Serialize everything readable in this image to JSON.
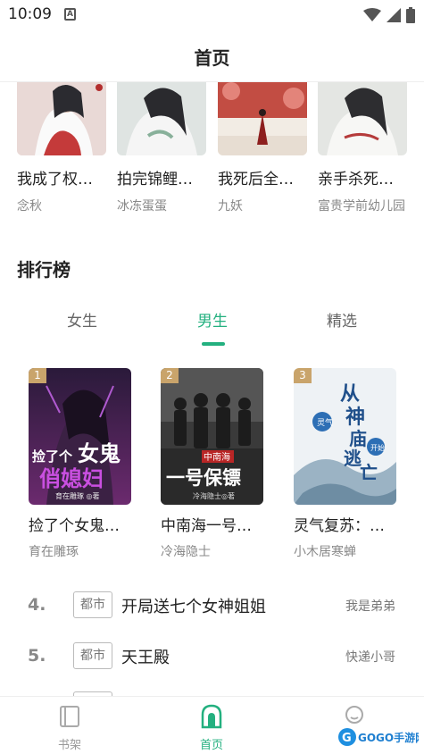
{
  "status_bar": {
    "time": "10:09",
    "sim_letter": "A"
  },
  "header": {
    "title": "首页"
  },
  "top_books": [
    {
      "title": "我成了权…",
      "author": "念秋"
    },
    {
      "title": "拍完锦鲤…",
      "author": "冰冻蛋蛋"
    },
    {
      "title": "我死后全…",
      "author": "九妖"
    },
    {
      "title": "亲手杀死…",
      "author": "富贵学前幼儿园"
    }
  ],
  "ranking": {
    "title": "排行榜",
    "tabs": [
      {
        "label": "女生",
        "active": false
      },
      {
        "label": "男生",
        "active": true
      },
      {
        "label": "精选",
        "active": false
      }
    ],
    "top3": [
      {
        "rank": "1",
        "title": "捡了个女鬼…",
        "author": "育在雕琢",
        "cover_text": "捡了个女鬼俏媳妇"
      },
      {
        "rank": "2",
        "title": "中南海一号…",
        "author": "冷海隐士",
        "cover_text": "中南海一号保镖"
      },
      {
        "rank": "3",
        "title": "灵气复苏：…",
        "author": "小木居寒蝉",
        "cover_text": "从神庙逃亡开始"
      }
    ],
    "list": [
      {
        "rank": "4.",
        "tag": "都市",
        "title": "开局送七个女神姐姐",
        "author": "我是弟弟"
      },
      {
        "rank": "5.",
        "tag": "都市",
        "title": "天王殿",
        "author": "快递小哥"
      }
    ]
  },
  "bottom_nav": [
    {
      "label": "书架",
      "icon": "bookshelf-icon",
      "active": false
    },
    {
      "label": "首页",
      "icon": "home-icon",
      "active": true
    },
    {
      "label": "",
      "icon": "profile-icon",
      "active": false
    }
  ],
  "watermark": {
    "text": "GOGO手游网"
  },
  "colors": {
    "accent": "#23b07f",
    "rank_badge": "#c9a46b"
  }
}
